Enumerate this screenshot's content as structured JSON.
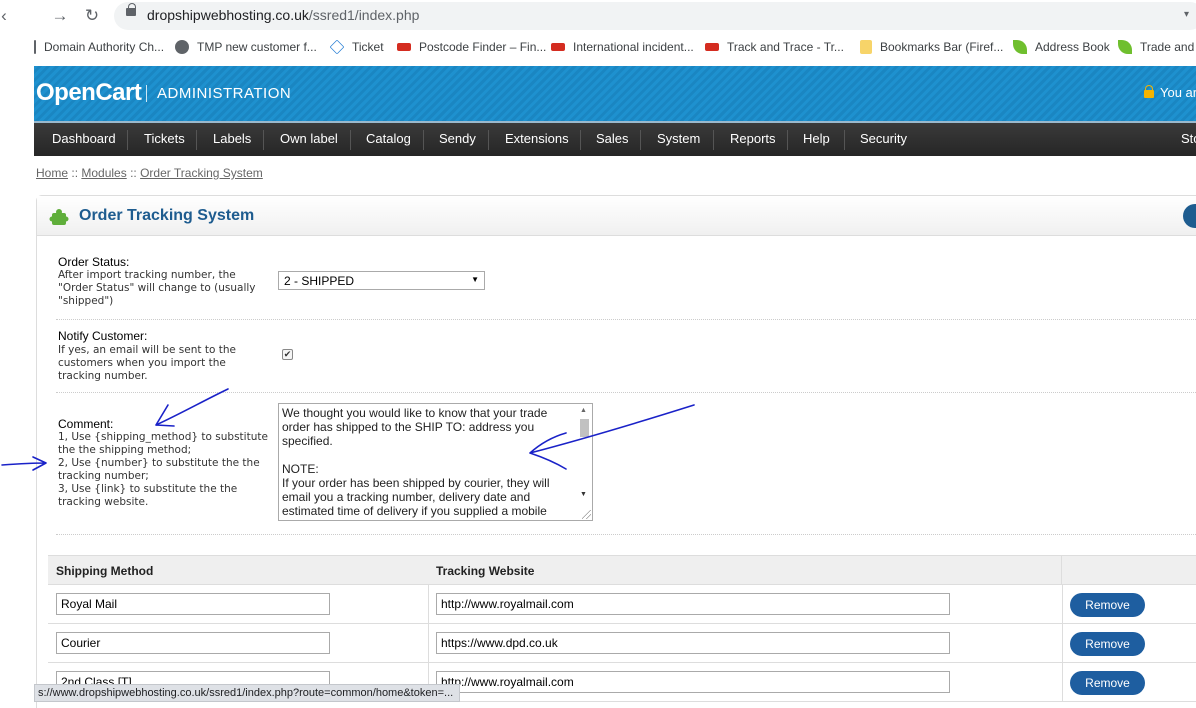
{
  "browser": {
    "url_host": "dropshipwebhosting.co.uk",
    "url_path": "/ssred1/index.php",
    "bookmarks": [
      {
        "label": "Domain Authority Ch...",
        "icon": "page-icon"
      },
      {
        "label": "TMP new customer f...",
        "icon": "globe-icon"
      },
      {
        "label": "Ticket",
        "icon": "diamond-icon"
      },
      {
        "label": "Postcode Finder – Fin...",
        "icon": "royal-mail-icon"
      },
      {
        "label": "International incident...",
        "icon": "royal-mail-icon"
      },
      {
        "label": "Track and Trace - Tr...",
        "icon": "royal-mail-icon"
      },
      {
        "label": "Bookmarks Bar (Firef...",
        "icon": "folder-icon"
      },
      {
        "label": "Address Book",
        "icon": "leaf-icon"
      },
      {
        "label": "Trade and",
        "icon": "leaf-icon"
      }
    ],
    "status_url": "s://www.dropshipwebhosting.co.uk/ssred1/index.php?route=common/home&token=..."
  },
  "header": {
    "logo": "OpenCart",
    "admin_label": "ADMINISTRATION",
    "user_text": "You ar"
  },
  "menu": [
    "Dashboard",
    "Tickets",
    "Labels",
    "Own label",
    "Catalog",
    "Sendy",
    "Extensions",
    "Sales",
    "System",
    "Reports",
    "Help",
    "Security",
    "Sto"
  ],
  "breadcrumb": {
    "home": "Home",
    "sep": "::",
    "modules": "Modules",
    "current": "Order Tracking System"
  },
  "page": {
    "title": "Order Tracking System"
  },
  "form": {
    "order_status": {
      "label": "Order Status:",
      "help": "After import tracking number, the \"Order Status\" will change to (usually \"shipped\")",
      "value": "2 - SHIPPED"
    },
    "notify": {
      "label": "Notify Customer:",
      "help": "If yes, an email will be sent to the customers when you import the tracking number.",
      "checked": "✔"
    },
    "comment": {
      "label": "Comment:",
      "help": "1, Use {shipping_method} to substitute the the shipping method;\n2, Use {number} to substitute the the tracking number;\n3, Use {link} to substitute the the tracking website.",
      "value": "We thought you would like to know that your trade order has shipped to the SHIP TO: address you specified.\n\nNOTE:\nIf your order has been shipped by courier, they will email you a tracking number, delivery date and estimated time of delivery if you supplied a mobile"
    }
  },
  "table": {
    "headers": [
      "Shipping Method",
      "Tracking Website",
      ""
    ],
    "rows": [
      {
        "method": "Royal Mail",
        "website": "http://www.royalmail.com",
        "action": "Remove"
      },
      {
        "method": "Courier",
        "website": "https://www.dpd.co.uk",
        "action": "Remove"
      },
      {
        "method": "2nd Class [T]",
        "website": "http://www.royalmail.com",
        "action": "Remove"
      }
    ]
  },
  "colors": {
    "header_blue": "#1e91cf",
    "menu_dark": "#2d2d2d",
    "title_blue": "#1e5c8f",
    "button_blue": "#1e5ea0",
    "annotation_ink": "#1a22c8"
  }
}
